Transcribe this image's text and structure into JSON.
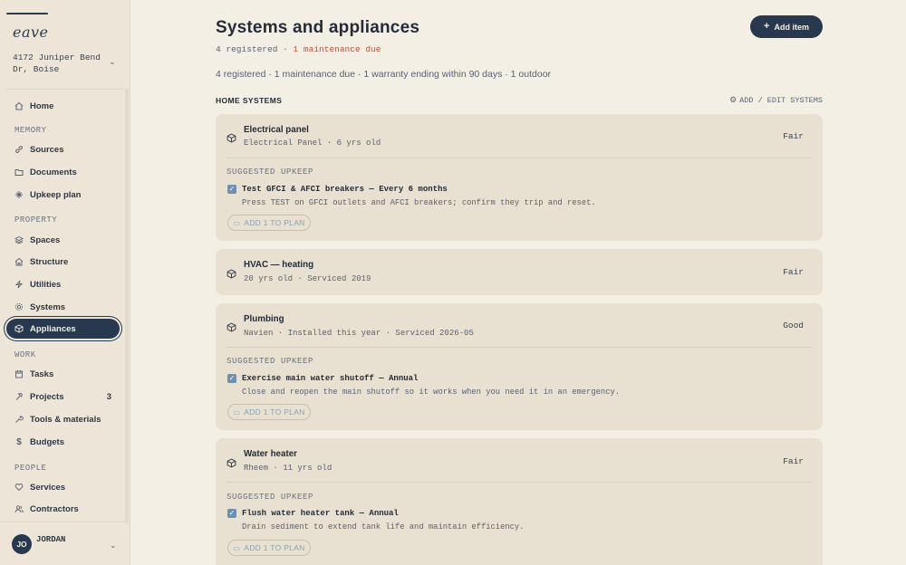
{
  "sidebar": {
    "logo": "eave",
    "address": "4172 Juniper Bend Dr, Boise",
    "sections": {
      "memory": "MEMORY",
      "property": "PROPERTY",
      "work": "WORK",
      "people": "PEOPLE"
    },
    "items": [
      {
        "label": "Home",
        "icon": "home-icon"
      },
      {
        "label": "Sources",
        "icon": "link-icon"
      },
      {
        "label": "Documents",
        "icon": "folder-icon"
      },
      {
        "label": "Upkeep plan",
        "icon": "sparkle-icon"
      },
      {
        "label": "Spaces",
        "icon": "layers-icon"
      },
      {
        "label": "Structure",
        "icon": "house-icon"
      },
      {
        "label": "Utilities",
        "icon": "bolt-icon"
      },
      {
        "label": "Systems",
        "icon": "gear-icon"
      },
      {
        "label": "Appliances",
        "icon": "box-icon",
        "active": true
      },
      {
        "label": "Tasks",
        "icon": "calendar-icon"
      },
      {
        "label": "Projects",
        "icon": "hammer-icon",
        "count": "3"
      },
      {
        "label": "Tools & materials",
        "icon": "wrench-icon"
      },
      {
        "label": "Budgets",
        "icon": "dollar-icon"
      },
      {
        "label": "Services",
        "icon": "heart-icon"
      },
      {
        "label": "Contractors",
        "icon": "users-icon"
      }
    ],
    "user": {
      "initials": "JO",
      "name": "JORDAN"
    }
  },
  "header": {
    "title": "Systems and appliances",
    "add_button": "Add item",
    "registered_mono": "4 registered",
    "due_mono": "1 maintenance due",
    "separator": "·",
    "summary": "4 registered · 1 maintenance due · 1 warranty ending within 90 days · 1 outdoor"
  },
  "section": {
    "title": "HOME SYSTEMS",
    "action": "ADD / EDIT SYSTEMS"
  },
  "cards": [
    {
      "name": "Electrical panel",
      "meta": "Electrical Panel · 6 yrs old",
      "status": "Fair",
      "upkeep_label": "SUGGESTED UPKEEP",
      "task_title": "Test GFCI & AFCI breakers — Every 6 months",
      "task_desc": "Press TEST on GFCI outlets and AFCI breakers; confirm they trip and reset.",
      "plan_button": "ADD 1 TO PLAN"
    },
    {
      "name": "HVAC — heating",
      "meta": "20 yrs old · Serviced 2019",
      "status": "Fair"
    },
    {
      "name": "Plumbing",
      "meta": "Navien · Installed this year · Serviced 2026-05",
      "status": "Good",
      "upkeep_label": "SUGGESTED UPKEEP",
      "task_title": "Exercise main water shutoff — Annual",
      "task_desc": "Close and reopen the main shutoff so it works when you need it in an emergency.",
      "plan_button": "ADD 1 TO PLAN"
    },
    {
      "name": "Water heater",
      "meta": "Rheem · 11 yrs old",
      "status": "Fair",
      "upkeep_label": "SUGGESTED UPKEEP",
      "task_title": "Flush water heater tank — Annual",
      "task_desc": "Drain sediment to extend tank life and maintain efficiency.",
      "plan_button": "ADD 1 TO PLAN"
    }
  ],
  "colors": {
    "accent": "#27384f",
    "due": "#b2553a",
    "card_bg": "#e8e0d0",
    "page_bg": "#f4efe5",
    "check": "#6f8fb0"
  }
}
